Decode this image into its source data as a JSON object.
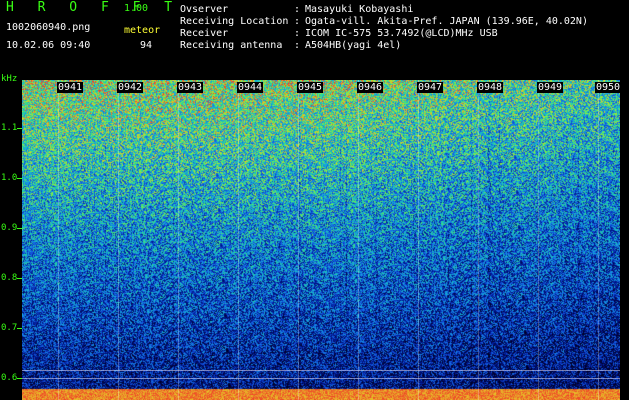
{
  "header": {
    "app_title": "H R O F F T",
    "app_version": "1.00",
    "filename": "1002060940.png",
    "datetime": "10.02.06 09:40",
    "meteor_label": "meteor",
    "meteor_count": "94",
    "info": [
      {
        "label": "Ovserver",
        "value": "Masayuki Kobayashi"
      },
      {
        "label": "Receiving Location",
        "value": "Ogata-vill. Akita-Pref. JAPAN (139.96E, 40.02N)"
      },
      {
        "label": "Receiver",
        "value": "ICOM IC-575 53.7492(@LCD)MHz USB"
      },
      {
        "label": "Receiving antenna",
        "value": "A504HB(yagi 4el)"
      }
    ]
  },
  "y_axis": {
    "unit": "kHz",
    "ticks": [
      "1.1",
      "1.0",
      "0.9",
      "0.8",
      "0.7",
      "0.6"
    ]
  },
  "time_axis": {
    "labels": [
      "0941",
      "0942",
      "0943",
      "0944",
      "0945",
      "0946",
      "0947",
      "0948",
      "0949",
      "0950"
    ]
  },
  "colors": {
    "text_green": "#39ff14",
    "text_white": "#ffffff",
    "text_yellow": "#ffff33",
    "background": "#000000"
  }
}
